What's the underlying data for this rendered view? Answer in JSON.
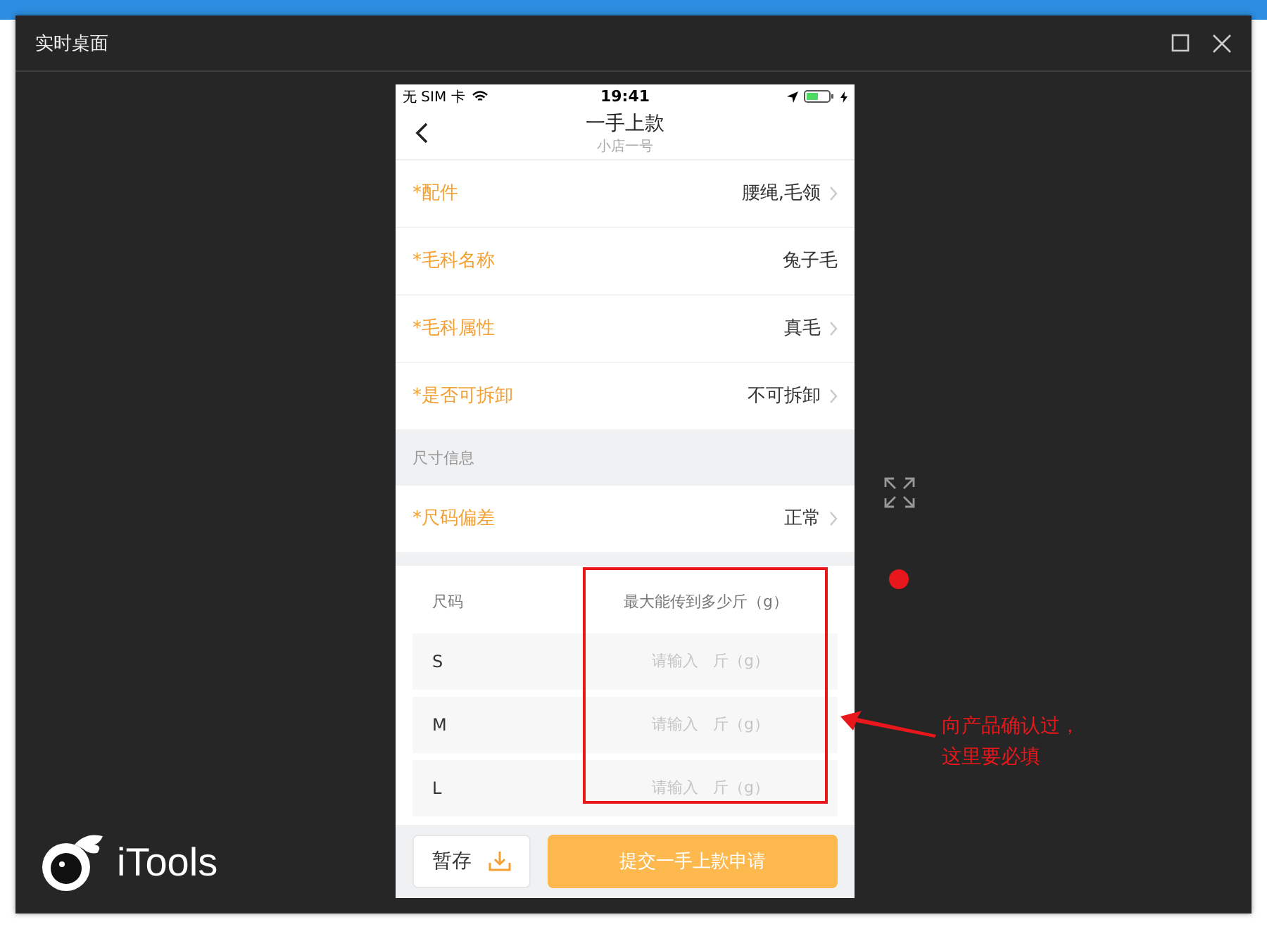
{
  "window": {
    "title": "实时桌面"
  },
  "phone": {
    "status_bar": {
      "carrier": "无 SIM 卡",
      "time": "19:41"
    },
    "nav": {
      "title": "一手上款",
      "subtitle": "小店一号"
    },
    "fields": [
      {
        "label": "*配件",
        "value": "腰绳,毛领",
        "has_arrow": true
      },
      {
        "label": "*毛科名称",
        "value": "兔子毛",
        "has_arrow": false
      },
      {
        "label": "*毛科属性",
        "value": "真毛",
        "has_arrow": true
      },
      {
        "label": "*是否可拆卸",
        "value": "不可拆卸",
        "has_arrow": true
      }
    ],
    "section_title": "尺寸信息",
    "size_fields": [
      {
        "label": "*尺码偏差",
        "value": "正常",
        "has_arrow": true
      }
    ],
    "size_table": {
      "columns": [
        "尺码",
        "最大能传到多少斤（g）"
      ],
      "rows": [
        {
          "size": "S",
          "placeholder": "请输入",
          "unit": "斤（g）"
        },
        {
          "size": "M",
          "placeholder": "请输入",
          "unit": "斤（g）"
        },
        {
          "size": "L",
          "placeholder": "请输入",
          "unit": "斤（g）"
        }
      ]
    },
    "save_button": "暂存",
    "submit_button": "提交一手上款申请"
  },
  "annotation": [
    "向产品确认过，",
    "这里要必填"
  ],
  "logo": "iTools"
}
